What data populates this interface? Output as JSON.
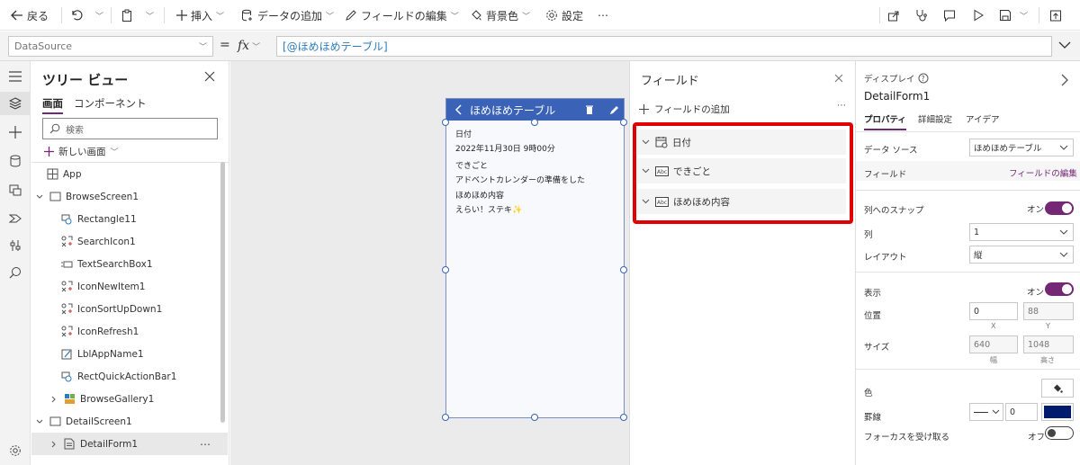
{
  "toolbar": {
    "back": "戻る",
    "insert": "挿入",
    "add_data": "データの追加",
    "edit_fields": "フィールドの編集",
    "background": "背景色",
    "settings": "設定",
    "more": "⋯"
  },
  "formula_bar": {
    "property": "DataSource",
    "equals": "=",
    "fx": "fx",
    "formula": "[@ほめほめテーブル]"
  },
  "tree_view": {
    "title": "ツリー ビュー",
    "tabs": [
      "画面",
      "コンポーネント"
    ],
    "search_placeholder": "検索",
    "new_screen": "新しい画面",
    "items": [
      {
        "label": "App",
        "icon": "app-icon"
      },
      {
        "label": "BrowseScreen1",
        "icon": "screen-icon"
      },
      {
        "label": "Rectangle11",
        "icon": "shape-icon"
      },
      {
        "label": "SearchIcon1",
        "icon": "icons-icon"
      },
      {
        "label": "TextSearchBox1",
        "icon": "textinput-icon"
      },
      {
        "label": "IconNewItem1",
        "icon": "icons-icon"
      },
      {
        "label": "IconSortUpDown1",
        "icon": "icons-icon"
      },
      {
        "label": "IconRefresh1",
        "icon": "icons-icon"
      },
      {
        "label": "LblAppName1",
        "icon": "label-icon"
      },
      {
        "label": "RectQuickActionBar1",
        "icon": "shape-icon"
      },
      {
        "label": "BrowseGallery1",
        "icon": "gallery-icon"
      },
      {
        "label": "DetailScreen1",
        "icon": "screen-icon"
      },
      {
        "label": "DetailForm1",
        "icon": "form-icon"
      }
    ],
    "item_more": "⋯"
  },
  "app_preview": {
    "title": "ほめほめテーブル",
    "field1_label": "日付",
    "field1_value": "2022年11月30日 9時00分",
    "field2_label": "できごと",
    "field2_value": "アドベントカレンダーの準備をした",
    "field3_label": "ほめほめ内容",
    "field3_value": "えらい！ステキ✨"
  },
  "fields_pane": {
    "title": "フィールド",
    "add_field": "フィールドの追加",
    "more": "⋯",
    "fields": [
      "日付",
      "できごと",
      "ほめほめ内容"
    ]
  },
  "properties": {
    "type": "ディスプレイ",
    "name": "DetailForm1",
    "tabs": [
      "プロパティ",
      "詳細設定",
      "アイデア"
    ],
    "datasource_label": "データ ソース",
    "datasource_value": "ほめほめテーブル",
    "fields_label": "フィールド",
    "fields_link": "フィールドの編集",
    "snap_label": "列へのスナップ",
    "snap_value": "オン",
    "columns_label": "列",
    "columns_value": "1",
    "layout_label": "レイアウト",
    "layout_value": "縦",
    "visible_label": "表示",
    "visible_value": "オン",
    "position_label": "位置",
    "pos_x": "0",
    "pos_y": "88",
    "x_label": "X",
    "y_label": "Y",
    "size_label": "サイズ",
    "width": "640",
    "height": "1048",
    "width_label": "幅",
    "height_label": "高さ",
    "color_label": "色",
    "border_label": "罫線",
    "border_width": "0",
    "border_color": "#001a6e",
    "focus_label": "フォーカスを受け取る",
    "focus_value": "オフ"
  },
  "colors": {
    "accent": "#742774",
    "header_blue": "#3a63b7",
    "highlight_red": "#e00000"
  }
}
